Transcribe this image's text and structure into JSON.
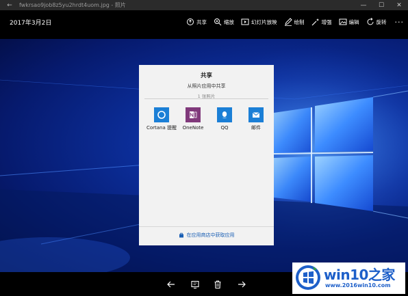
{
  "window": {
    "title": "fwkrsao9job8z5yu2hrdt4uom.jpg - 照片",
    "back_glyph": "←",
    "controls": {
      "minimize": "—",
      "maximize": "☐",
      "close": "✕"
    }
  },
  "commandbar": {
    "date": "2017年3月2日",
    "commands": [
      {
        "label": "共享",
        "icon": "share-icon"
      },
      {
        "label": "缩放",
        "icon": "zoom-icon"
      },
      {
        "label": "幻灯片放映",
        "icon": "slideshow-icon"
      },
      {
        "label": "绘制",
        "icon": "draw-icon"
      },
      {
        "label": "增强",
        "icon": "enhance-icon"
      },
      {
        "label": "编辑",
        "icon": "edit-icon"
      },
      {
        "label": "旋转",
        "icon": "rotate-icon"
      }
    ],
    "more": "···"
  },
  "share_dialog": {
    "title": "共享",
    "subtitle": "从照片应用中共享",
    "count": "1 张照片",
    "apps": [
      {
        "label": "Cortana 提醒",
        "icon": "cortana-icon",
        "color": "#1b7fd6"
      },
      {
        "label": "OneNote",
        "icon": "onenote-icon",
        "color": "#80397b"
      },
      {
        "label": "QQ",
        "icon": "qq-icon",
        "color": "#1b7fd6"
      },
      {
        "label": "邮件",
        "icon": "mail-icon",
        "color": "#1b7fd6"
      }
    ],
    "store_link": "在应用商店中获取应用"
  },
  "bottombar": {
    "buttons": [
      {
        "name": "previous",
        "icon": "arrow-left-icon"
      },
      {
        "name": "slideshow",
        "icon": "slideshow-icon"
      },
      {
        "name": "delete",
        "icon": "trash-icon"
      },
      {
        "name": "next",
        "icon": "arrow-right-icon"
      }
    ]
  },
  "watermark": {
    "brand": "win10之家",
    "url": "www.2016win10.com"
  },
  "colors": {
    "accent": "#1b7fd6",
    "onenote": "#80397b",
    "wallpaper": "#0c2f9c"
  }
}
